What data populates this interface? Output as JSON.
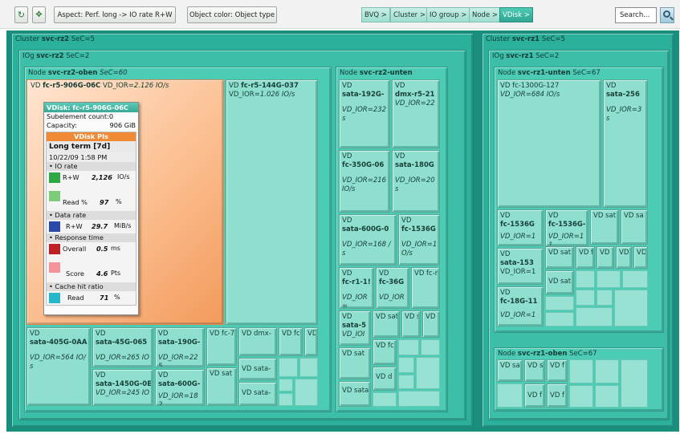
{
  "toolbar": {
    "aspect_label": "Aspect: Perf. long -> IO rate R+W",
    "color_label": "Object color: Object type",
    "search_label": "Search...",
    "breadcrumbs": [
      "BVQ >",
      "Cluster >",
      "IO group >",
      "Node >",
      "VDisk >"
    ]
  },
  "colors": {
    "selected": "#f8a86b",
    "treemap": "#4ccbb5",
    "accent": "#2fa792"
  },
  "clusters": [
    {
      "label": "Cluster",
      "name": "svc-rz2",
      "sec": "SeC=5",
      "iogroup": {
        "label": "IOg",
        "name": "svc-rz2",
        "sec": "SeC=2",
        "nodes": [
          {
            "label": "Node",
            "name": "svc-rz2-oben",
            "sec": "SeC=60"
          },
          {
            "label": "Node",
            "name": "svc-rz2-unten",
            "sec": ""
          }
        ]
      }
    },
    {
      "label": "Cluster",
      "name": "svc-rz1",
      "sec": "SeC=5",
      "iogroup": {
        "label": "IOg",
        "name": "svc-rz1",
        "sec": "SeC=2",
        "nodes": [
          {
            "label": "Node",
            "name": "svc-rz1-unten",
            "sec": "SeC=67"
          },
          {
            "label": "Node",
            "name": "svc-rz1-oben",
            "sec": "SeC=67"
          }
        ]
      }
    }
  ],
  "vdisks": {
    "selected": {
      "prefix": "VD",
      "name": "fc-r5-906G-06C",
      "ior_prefix": "VD_IOR=",
      "ior": "2.126 IO/s"
    },
    "big2": {
      "prefix": "VD",
      "name": "fc-r5-144G-037",
      "ior_prefix": "VD_IOR=",
      "ior": "1.026 IO/s"
    },
    "bottom": [
      {
        "prefix": "VD",
        "name": "sata-405G-0AA",
        "ior": "VD_IOR=564 IO/ s"
      },
      {
        "prefix": "VD",
        "name": "sata-45G-065",
        "ior": "VD_IOR=265 IO"
      },
      {
        "prefix": "VD",
        "name": "sata-1450G-0E",
        "ior": "VD_IOR=245 IO"
      },
      {
        "prefix": "VD",
        "name": "sata-190G-",
        "ior": "VD_IOR=225"
      },
      {
        "prefix": "VD",
        "name": "sata-600G-",
        "ior": "VD_IOR=182"
      },
      {
        "prefix": "VD fc-7",
        "name": "",
        "ior": ""
      },
      {
        "prefix": "VD sat",
        "name": "",
        "ior": ""
      },
      {
        "prefix": "VD dmx-",
        "name": "",
        "ior": ""
      },
      {
        "prefix": "VD sata-",
        "name": "",
        "ior": ""
      },
      {
        "prefix": "VD sata-",
        "name": "",
        "ior": ""
      },
      {
        "prefix": "VD fc",
        "name": "",
        "ior": ""
      },
      {
        "prefix": "VD :",
        "name": "",
        "ior": ""
      }
    ],
    "unten2": [
      {
        "prefix": "VD",
        "name": "sata-192G-",
        "ior": "VD_IOR=232 s"
      },
      {
        "prefix": "VD",
        "name": "dmx-r5-21",
        "ior": "VD_IOR=22"
      },
      {
        "prefix": "VD",
        "name": "fc-350G-06",
        "ior": "VD_IOR=216 IO/s"
      },
      {
        "prefix": "VD",
        "name": "sata-180G",
        "ior": "VD_IOR=20 s"
      },
      {
        "prefix": "VD",
        "name": "sata-600G-0",
        "ior": "VD_IOR=168 / s"
      },
      {
        "prefix": "VD",
        "name": "fc-1536G",
        "ior": "VD_IOR=1 O/s"
      },
      {
        "prefix": "VD",
        "name": "fc-r1-1!",
        "ior": "VD_IOR="
      },
      {
        "prefix": "VD",
        "name": "fc-36G",
        "ior": "VD_IOR"
      },
      {
        "prefix": "VD fc-r",
        "name": "",
        "ior": ""
      },
      {
        "prefix": "VD",
        "name": "sata-5",
        "ior": "VD_IOI"
      },
      {
        "prefix": "VD sat",
        "name": "",
        "ior": ""
      },
      {
        "prefix": "VD s",
        "name": "",
        "ior": ""
      },
      {
        "prefix": "VD s",
        "name": "",
        "ior": ""
      },
      {
        "prefix": "VD sat",
        "name": "",
        "ior": ""
      },
      {
        "prefix": "VD fc",
        "name": "",
        "ior": ""
      },
      {
        "prefix": "VD d",
        "name": "",
        "ior": ""
      },
      {
        "prefix": "VD sata",
        "name": "",
        "ior": ""
      }
    ],
    "rz1unten": [
      {
        "prefix": "VD",
        "name": "fc-1300G-127",
        "ior": "VD_IOR=684 IO/s"
      },
      {
        "prefix": "VD",
        "name": "sata-256",
        "ior": "VD_IOR=3 s"
      },
      {
        "prefix": "VD",
        "name": "fc-1536G",
        "ior": "VD_IOR=1"
      },
      {
        "prefix": "VD",
        "name": "fc-1536G-",
        "ior": "VD_IOR=11"
      },
      {
        "prefix": "VD sat",
        "name": "",
        "ior": ""
      },
      {
        "prefix": "VD sa",
        "name": "",
        "ior": ""
      },
      {
        "prefix": "VD sat",
        "name": "",
        "ior": ""
      },
      {
        "prefix": "VD f",
        "name": "",
        "ior": ""
      },
      {
        "prefix": "VD s",
        "name": "",
        "ior": ""
      },
      {
        "prefix": "VD r",
        "name": "",
        "ior": ""
      },
      {
        "prefix": "VD",
        "name": "",
        "ior": ""
      },
      {
        "prefix": "VD",
        "name": "sata-153",
        "ior": "VD_IOR=1"
      },
      {
        "prefix": "VD sat",
        "name": "",
        "ior": ""
      },
      {
        "prefix": "VD",
        "name": "fc-18G-11",
        "ior": "VD_IOR=1"
      }
    ],
    "rz1oben": [
      {
        "prefix": "VD sat",
        "name": "",
        "ior": ""
      },
      {
        "prefix": "VD s",
        "name": "",
        "ior": ""
      },
      {
        "prefix": "VD f",
        "name": "",
        "ior": ""
      },
      {
        "prefix": "VD f",
        "name": "",
        "ior": ""
      },
      {
        "prefix": "VD f",
        "name": "",
        "ior": ""
      }
    ]
  },
  "popup": {
    "title": "VDisk: fc-r5-906G-06C",
    "subelement_label": "Subelement count:",
    "subelement_value": "0",
    "capacity_label": "Capacity:",
    "capacity_value": "906 GiB",
    "pis_header": "VDisk PIs",
    "term": "Long term [7d]",
    "datetime": "10/22/09 1:58 PM",
    "sections": {
      "io_rate": "• IO rate",
      "data_rate": "• Data rate",
      "response_time": "• Response time",
      "cache_hit": "• Cache hit ratio"
    },
    "metrics": [
      {
        "label": "R+W",
        "value": "2,126",
        "unit": "IO/s",
        "color": "#2ea843"
      },
      {
        "label": "Read %",
        "value": "97",
        "unit": "%",
        "color": "#7ccc7a"
      },
      {
        "label": "R+W",
        "value": "29.7",
        "unit": "MiB/s",
        "color": "#2a49a8"
      },
      {
        "label": "Overall",
        "value": "0.5",
        "unit": "ms",
        "color": "#c01f24"
      },
      {
        "label": "Score",
        "value": "4.6",
        "unit": "Pts",
        "color": "#f3939a"
      },
      {
        "label": "Read",
        "value": "71",
        "unit": "%",
        "color": "#24b7c9"
      }
    ]
  }
}
